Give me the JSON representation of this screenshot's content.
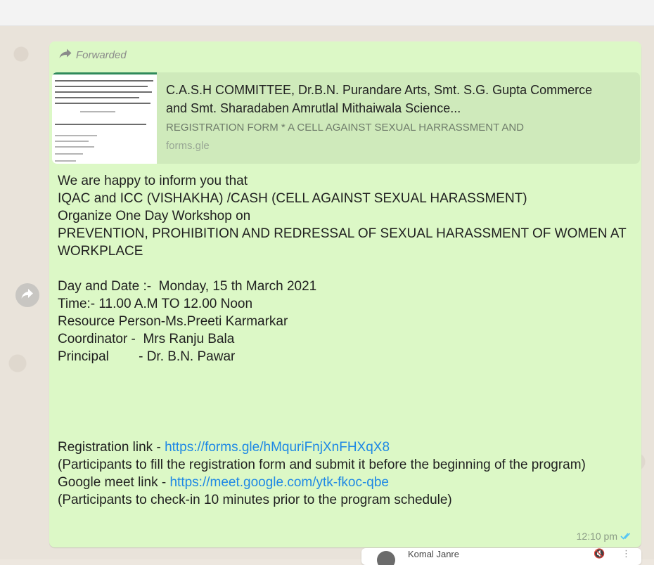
{
  "message": {
    "forwarded_label": "Forwarded",
    "preview": {
      "title": "C.A.S.H COMMITTEE, Dr.B.N. Purandare Arts, Smt. S.G. Gupta Commerce and Smt. Sharadaben Amrutlal Mithaiwala Science...",
      "description": "REGISTRATION FORM * A CELL AGAINST SEXUAL HARRASSMENT AND",
      "domain": "forms.gle"
    },
    "lines": [
      "We are happy to inform you that",
      "IQAC and ICC (VISHAKHA) /CASH (CELL AGAINST SEXUAL HARASSMENT)",
      "Organize One Day Workshop on",
      "PREVENTION, PROHIBITION AND REDRESSAL OF SEXUAL HARASSMENT OF WOMEN AT WORKPLACE",
      "Day and Date :-  Monday, 15 th March 2021",
      "Time:- 11.00 A.M TO 12.00 Noon",
      "Resource Person-Ms.Preeti Karmarkar",
      "Coordinator -  Mrs Ranju Bala",
      "Principal        - Dr. B.N. Pawar"
    ],
    "registration": {
      "label": "Registration link - ",
      "url": "https://forms.gle/hMquriFnjXnFHXqX8",
      "note": "(Participants to fill the registration form and submit it before the beginning of the program)"
    },
    "meet": {
      "label": "Google meet link - ",
      "url": "https://meet.google.com/ytk-fkoc-qbe",
      "note": "(Participants to check-in 10 minutes prior to the program schedule)"
    },
    "time": "12:10 pm",
    "status_icon": "double-check-read-icon",
    "status_color": "#4fc3f7"
  },
  "bottom_card": {
    "name": "Komal Janre"
  },
  "colors": {
    "bubble": "#dcf8c6",
    "link": "#1e88e5",
    "chat_background": "#e9e3da"
  }
}
